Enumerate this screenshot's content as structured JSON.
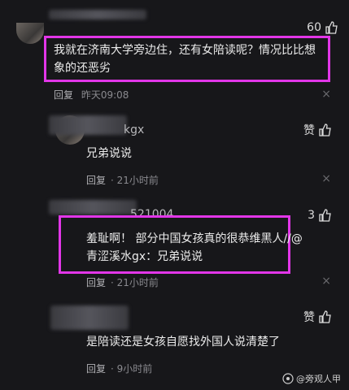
{
  "comments": [
    {
      "likes": "60",
      "text": "我就在济南大学旁边住，还有女陪读呢？情况比比想象的还恶劣",
      "reply_label": "回复",
      "time": "昨天09:08"
    },
    {
      "username": "kgx",
      "likes": "赞",
      "text": "兄弟说说",
      "reply_label": "回复",
      "time": "21小时前"
    },
    {
      "username": "521004",
      "likes": "3",
      "text": "羞耻啊！ 部分中国女孩真的很恭维黑人//@青涩溪水gx：兄弟说说",
      "reply_label": "回复",
      "time": "21小时前"
    },
    {
      "likes": "赞",
      "text": "是陪读还是女孩自愿找外国人说清楚了",
      "reply_label": "回复",
      "time": "9小时前"
    }
  ],
  "close_glyph": "×",
  "watermark": "@旁观人甲",
  "colors": {
    "highlight": "#e236e8",
    "background": "#17171a"
  }
}
